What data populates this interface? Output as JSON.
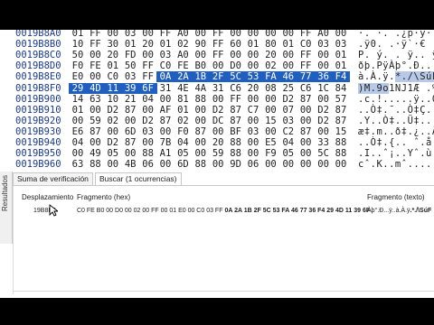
{
  "hex_rows": [
    {
      "addr": "0019B8A0",
      "bytes": [
        "01",
        "FF",
        "00",
        "03",
        "00",
        "FF",
        "A0",
        "00",
        "FF",
        "00",
        "00",
        "00",
        "00",
        "FF",
        "A0",
        "00"
      ],
      "text": "·. ·. .¿p·ÿ·· ·"
    },
    {
      "addr": "0019B8B0",
      "bytes": [
        "10",
        "FF",
        "30",
        "01",
        "20",
        "01",
        "02",
        "90",
        "FF",
        "60",
        "01",
        "80",
        "01",
        "C0",
        "03",
        "03"
      ],
      "text": ".ÿ0. .·ÿ`·€ .À."
    },
    {
      "addr": "0019B8C0",
      "bytes": [
        "50",
        "00",
        "20",
        "FD",
        "00",
        "03",
        "A0",
        "00",
        "FF",
        "00",
        "00",
        "20",
        "00",
        "FF",
        "00",
        "01"
      ],
      "text": "P. ý. . ÿ.. ÿ.."
    },
    {
      "addr": "0019B8D0",
      "bytes": [
        "F0",
        "FE",
        "01",
        "50",
        "FF",
        "C0",
        "FE",
        "B0",
        "00",
        "D0",
        "00",
        "02",
        "00",
        "FF",
        "00",
        "01"
      ],
      "text": "ðþ.PÿÀþ°.Ð...ÿ.."
    },
    {
      "addr": "0019B8E0",
      "bytes": [
        "E0",
        "00",
        "C0",
        "03",
        "FF",
        "0A",
        "2A",
        "1B",
        "2F",
        "5C",
        "53",
        "FA",
        "46",
        "77",
        "36",
        "F4"
      ],
      "text": "à.À.ÿ.*./\\SúFw6ô",
      "sel_from": 5,
      "text_sel": "*./\\SúF"
    },
    {
      "addr": "0019B8F0",
      "bytes": [
        "29",
        "4D",
        "11",
        "39",
        "6F",
        "31",
        "4E",
        "4A",
        "31",
        "C6",
        "20",
        "08",
        "25",
        "C6",
        "1C",
        "84"
      ],
      "text": ")M.9o1NJ1Æ .%Æ.„",
      "sel_to": 4,
      "text_sel": ")M.9o"
    },
    {
      "addr": "0019B900",
      "bytes": [
        "14",
        "63",
        "10",
        "21",
        "04",
        "00",
        "81",
        "88",
        "00",
        "FF",
        "00",
        "00",
        "D2",
        "87",
        "00",
        "57"
      ],
      "text": ".c.!.....ÿ..Ò‡.W"
    },
    {
      "addr": "0019B910",
      "bytes": [
        "01",
        "00",
        "D2",
        "87",
        "00",
        "AF",
        "01",
        "00",
        "D2",
        "87",
        "C7",
        "00",
        "07",
        "00",
        "D2",
        "87"
      ],
      "text": "..Ò‡.¯..Ò‡Ç...Ò‡"
    },
    {
      "addr": "0019B920",
      "bytes": [
        "00",
        "59",
        "02",
        "00",
        "D2",
        "87",
        "02",
        "00",
        "DC",
        "87",
        "00",
        "15",
        "03",
        "00",
        "D2",
        "87"
      ],
      "text": ".Y..Ò‡..Ü‡....Ò‡"
    },
    {
      "addr": "0019B930",
      "bytes": [
        "E6",
        "87",
        "00",
        "6D",
        "03",
        "00",
        "F0",
        "87",
        "00",
        "BF",
        "03",
        "00",
        "C2",
        "87",
        "00",
        "15"
      ],
      "text": "æ‡.m..ð‡.¿..Â‡.."
    },
    {
      "addr": "0019B940",
      "bytes": [
        "04",
        "00",
        "D2",
        "87",
        "00",
        "7B",
        "04",
        "00",
        "20",
        "88",
        "00",
        "E5",
        "04",
        "00",
        "33",
        "88"
      ],
      "text": "..Ò‡.{.. ˆ.å..3ˆ"
    },
    {
      "addr": "0019B950",
      "bytes": [
        "00",
        "49",
        "05",
        "00",
        "88",
        "A1",
        "05",
        "00",
        "59",
        "88",
        "00",
        "F9",
        "05",
        "00",
        "5C",
        "88"
      ],
      "text": ".I..ˆ¡..Yˆ.ù..\\ˆ"
    },
    {
      "addr": "0019B960",
      "bytes": [
        "63",
        "88",
        "00",
        "4B",
        "06",
        "00",
        "6D",
        "88",
        "00",
        "9D",
        "06",
        "00",
        "00",
        "00",
        "00",
        "00"
      ],
      "text": "cˆ.K..mˆ......."
    }
  ],
  "side_label": "Resultados",
  "tabs": [
    {
      "label": "Suma de verificación"
    },
    {
      "label": "Buscar (1 ocurrencias)"
    }
  ],
  "table": {
    "col_offset": "Desplazamiento",
    "col_hex": "Fragmento (hex)",
    "col_text": "Fragmento (texto)",
    "row": {
      "offset": "19B8E5",
      "hex_pre": "C0 FE B0 00 D0 00 02 00 FF 00 01 E0 00 C0 03 FF",
      "hex_match": "0A 2A 1B 2F 5C 53 FA 46 77 36 F4 29 4D 11 39 6F",
      "text_pre": "Àþ°.Ð...ÿ..à.À.ÿ",
      "text_match": ".*./\\SúF"
    }
  },
  "colors": {
    "selection": "#1f5fbf",
    "text_selection": "#b7c9e6",
    "address": "#1a3a8c"
  }
}
